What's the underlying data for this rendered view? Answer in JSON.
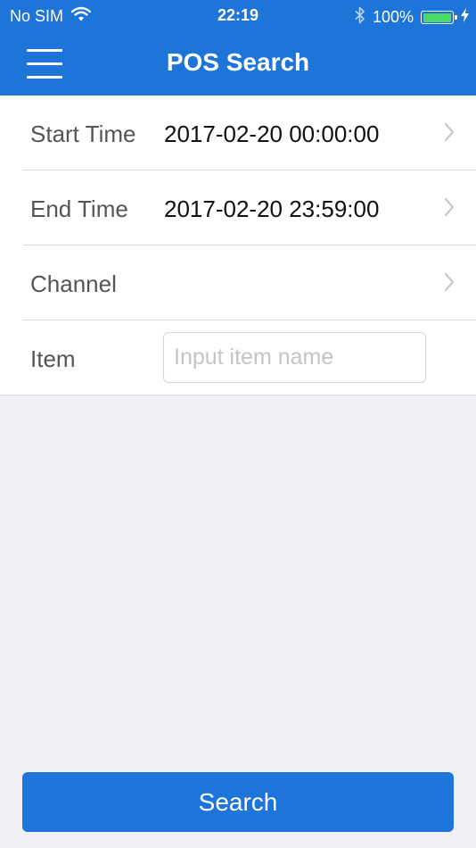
{
  "status_bar": {
    "carrier": "No SIM",
    "time": "22:19",
    "battery_percent": "100%",
    "battery_level": 1.0
  },
  "nav": {
    "title": "POS Search"
  },
  "form": {
    "start_time": {
      "label": "Start Time",
      "value": "2017-02-20 00:00:00"
    },
    "end_time": {
      "label": "End Time",
      "value": "2017-02-20 23:59:00"
    },
    "channel": {
      "label": "Channel",
      "value": ""
    },
    "item": {
      "label": "Item",
      "value": "",
      "placeholder": "Input item name"
    }
  },
  "actions": {
    "search_label": "Search"
  },
  "colors": {
    "primary": "#1d74d9",
    "background": "#efeff4",
    "battery_green": "#4cd964",
    "chevron": "#c7c7cc"
  }
}
